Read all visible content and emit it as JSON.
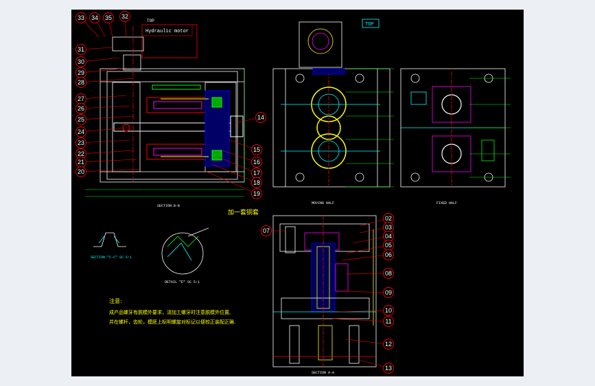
{
  "labels": {
    "top_left": "TOP",
    "top_right": "TOP",
    "hydraulic_motor": "Hydraulic motor",
    "section_bb": "SECTION B-B",
    "section_aa": "SECTION A-A",
    "moving_half": "MOVING HALF",
    "fixed_half": "FIXED HALF",
    "section_cc": "SECTION \"C-C\" SC 5:1",
    "detail_e": "DETAIL \"E\" SC 5:1",
    "cooling_note": "加一套铜套"
  },
  "notes": {
    "title": "注意:",
    "line1": "成产品螺牙有脱模外要求，浇加工螺牙时注意脱模外位置,",
    "line2": "并在螺杆，齿轮，模胚上标明螺旋对标记以便校正装配正确."
  },
  "balloons_left": [
    "33",
    "34",
    "35",
    "32",
    "31",
    "30",
    "29",
    "28",
    "27",
    "26",
    "25",
    "24",
    "23",
    "22",
    "21",
    "20"
  ],
  "balloons_right_bb": [
    "14",
    "15",
    "16",
    "17",
    "18",
    "19"
  ],
  "balloons_aa": [
    "07",
    "02",
    "03",
    "04",
    "05",
    "06",
    "08",
    "09",
    "10",
    "11",
    "12",
    "13"
  ],
  "colors": {
    "background": "#000000",
    "frame": "#eceff4",
    "outline": "#ffffff",
    "balloon": "#ff0000",
    "dimension": "#00ff00",
    "cooling": "#00ffff",
    "parting": "#ff00ff",
    "note": "#ffff00"
  }
}
